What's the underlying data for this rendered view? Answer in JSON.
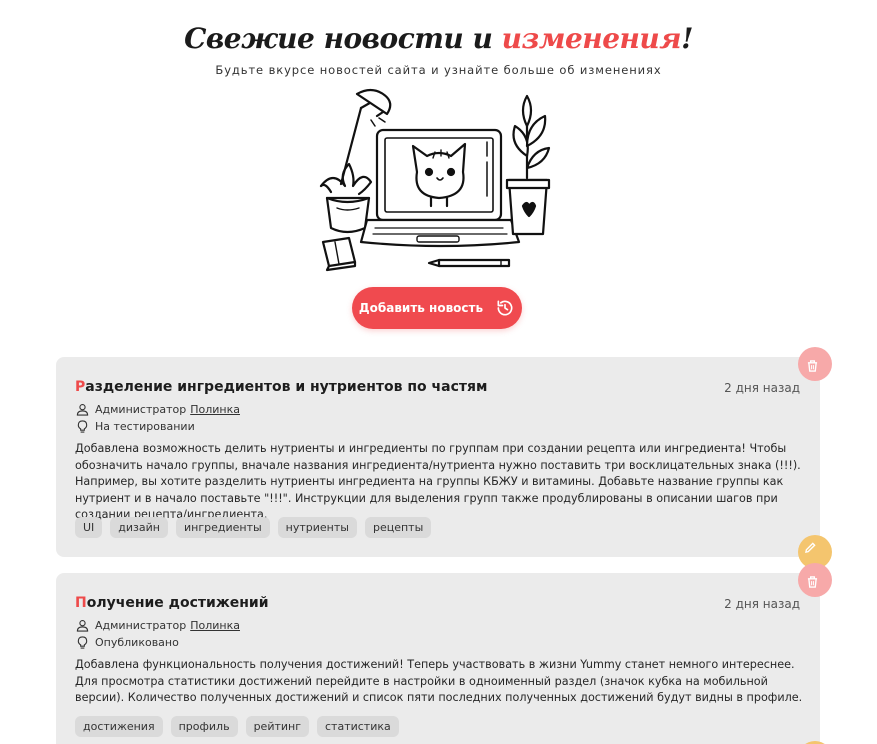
{
  "hero": {
    "title_main": "Свежие новости и ",
    "title_accent": "изменения",
    "title_end": "!",
    "subtitle": "Будьте вкурсе новостей сайта и узнайте больше об изменениях"
  },
  "add_button": {
    "label": "Добавить новость",
    "icon": "history-icon"
  },
  "colors": {
    "accent": "#ee4a4a",
    "button": "#f04a4f",
    "card": "#ebebeb",
    "tag": "#dadada",
    "delete": "#f7a9a9",
    "edit": "#f4c56e"
  },
  "news": [
    {
      "title_first": "Р",
      "title_rest": "азделение ингредиентов и нутриентов по частям",
      "date": "2 дня назад",
      "author_role": "Администратор",
      "author_name": "Полинка",
      "status": "На тестировании",
      "body": "Добавлена возможность делить нутриенты и ингредиенты по группам при создании рецепта или ингредиента! Чтобы обозначить начало группы, вначале названия ингредиента/нутриента нужно поставить три восклицательных знака (!!!). Например, вы хотите разделить нутриенты ингредиента на группы КБЖУ и витамины. Добавьте название группы как нутриент и в начало поставьте \"!!!\". Инструкции для выделения групп также продублированы в описании шагов при создании рецепта/ингредиента.",
      "tags": [
        "UI",
        "дизайн",
        "ингредиенты",
        "нутриенты",
        "рецепты"
      ]
    },
    {
      "title_first": "П",
      "title_rest": "олучение достижений",
      "date": "2 дня назад",
      "author_role": "Администратор",
      "author_name": "Полинка",
      "status": "Опубликовано",
      "body": "Добавлена функциональность получения достижений! Теперь участвовать в жизни Yummy станет немного интереснее. Для просмотра статистики достижений перейдите в настройки в одноименный раздел (значок кубка на мобильной версии). Количество полученных достижений и список пяти последних полученных достижений будут видны в профиле.",
      "tags": [
        "достижения",
        "профиль",
        "рейтинг",
        "статистика"
      ]
    }
  ]
}
